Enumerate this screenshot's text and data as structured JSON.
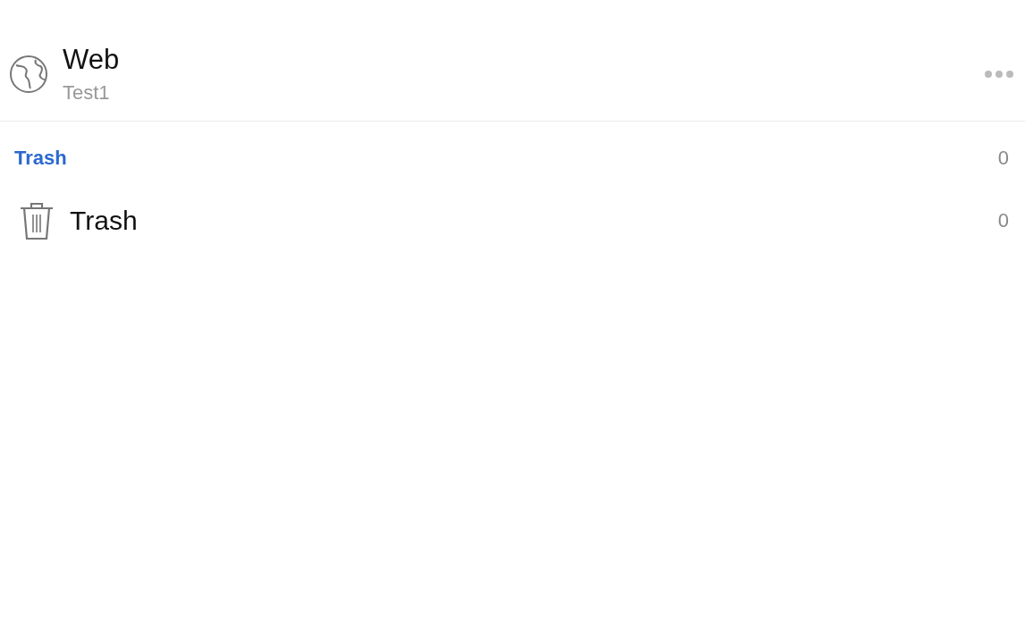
{
  "account": {
    "title": "Web",
    "subtitle": "Test1"
  },
  "section": {
    "title": "Trash",
    "count": "0"
  },
  "folders": [
    {
      "kind": "trash",
      "label": "Trash",
      "count": "0"
    }
  ]
}
